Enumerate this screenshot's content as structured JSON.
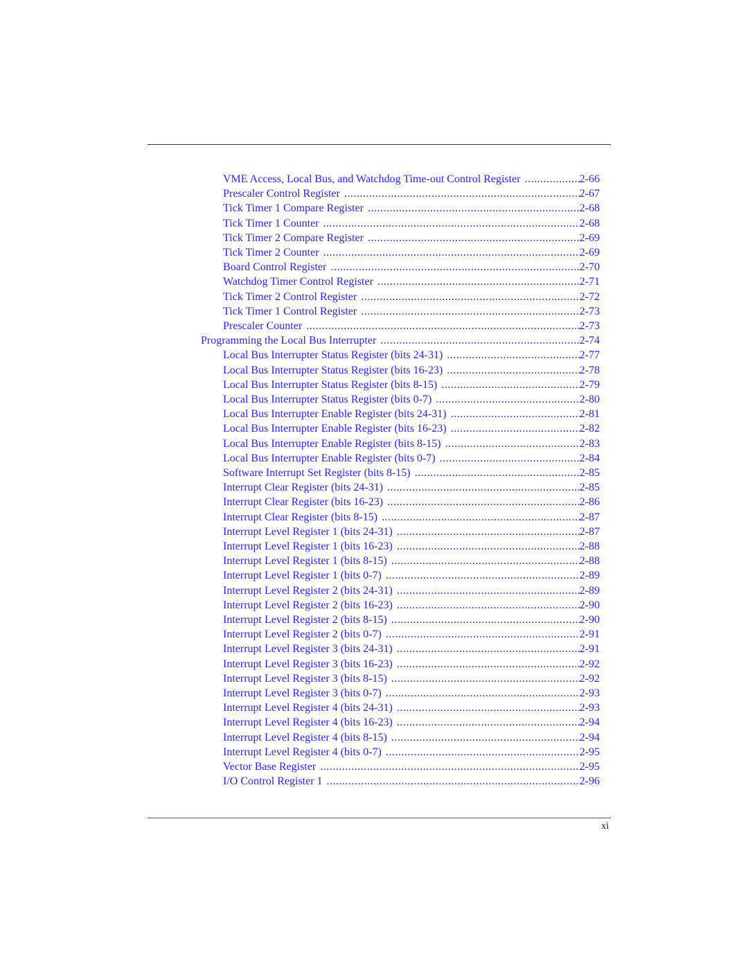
{
  "page_number": "xi",
  "colors": {
    "link": "#2424ff",
    "text": "#111111",
    "rule": "#333333"
  },
  "toc": [
    {
      "level": 2,
      "title": "VME Access, Local Bus, and Watchdog Time-out Control Register",
      "page": "2-66"
    },
    {
      "level": 2,
      "title": "Prescaler Control Register",
      "page": "2-67"
    },
    {
      "level": 2,
      "title": "Tick Timer 1 Compare Register",
      "page": "2-68"
    },
    {
      "level": 2,
      "title": "Tick Timer 1 Counter",
      "page": "2-68"
    },
    {
      "level": 2,
      "title": "Tick Timer 2 Compare Register",
      "page": "2-69"
    },
    {
      "level": 2,
      "title": "Tick Timer 2 Counter",
      "page": "2-69"
    },
    {
      "level": 2,
      "title": "Board Control Register",
      "page": "2-70"
    },
    {
      "level": 2,
      "title": "Watchdog Timer Control Register",
      "page": "2-71"
    },
    {
      "level": 2,
      "title": "Tick Timer 2 Control Register",
      "page": "2-72"
    },
    {
      "level": 2,
      "title": "Tick Timer 1 Control Register",
      "page": "2-73"
    },
    {
      "level": 2,
      "title": "Prescaler Counter",
      "page": "2-73"
    },
    {
      "level": 1,
      "title": "Programming the Local Bus Interrupter",
      "page": "2-74"
    },
    {
      "level": 2,
      "title": "Local Bus Interrupter Status Register (bits 24-31)",
      "page": "2-77"
    },
    {
      "level": 2,
      "title": "Local Bus Interrupter Status Register (bits 16-23)",
      "page": "2-78"
    },
    {
      "level": 2,
      "title": "Local Bus Interrupter Status Register (bits 8-15)",
      "page": "2-79"
    },
    {
      "level": 2,
      "title": "Local Bus Interrupter Status Register (bits 0-7)",
      "page": "2-80"
    },
    {
      "level": 2,
      "title": "Local Bus Interrupter Enable Register (bits 24-31)",
      "page": "2-81"
    },
    {
      "level": 2,
      "title": "Local Bus Interrupter Enable Register (bits 16-23)",
      "page": "2-82"
    },
    {
      "level": 2,
      "title": "Local Bus Interrupter Enable Register (bits 8-15)",
      "page": "2-83"
    },
    {
      "level": 2,
      "title": "Local Bus Interrupter Enable Register (bits 0-7)",
      "page": "2-84"
    },
    {
      "level": 2,
      "title": "Software Interrupt Set Register (bits 8-15)",
      "page": "2-85"
    },
    {
      "level": 2,
      "title": "Interrupt Clear Register (bits 24-31)",
      "page": "2-85"
    },
    {
      "level": 2,
      "title": "Interrupt Clear Register (bits 16-23)",
      "page": "2-86"
    },
    {
      "level": 2,
      "title": "Interrupt Clear Register (bits 8-15)",
      "page": "2-87"
    },
    {
      "level": 2,
      "title": "Interrupt Level Register 1 (bits 24-31)",
      "page": "2-87"
    },
    {
      "level": 2,
      "title": "Interrupt Level Register 1 (bits 16-23)",
      "page": "2-88"
    },
    {
      "level": 2,
      "title": "Interrupt Level Register 1 (bits 8-15)",
      "page": "2-88"
    },
    {
      "level": 2,
      "title": "Interrupt Level Register 1 (bits 0-7)",
      "page": "2-89"
    },
    {
      "level": 2,
      "title": "Interrupt Level Register 2 (bits 24-31)",
      "page": "2-89"
    },
    {
      "level": 2,
      "title": "Interrupt Level Register 2 (bits 16-23)",
      "page": "2-90"
    },
    {
      "level": 2,
      "title": "Interrupt Level Register 2 (bits 8-15)",
      "page": "2-90"
    },
    {
      "level": 2,
      "title": "Interrupt Level Register 2 (bits 0-7)",
      "page": "2-91"
    },
    {
      "level": 2,
      "title": "Interrupt Level Register 3 (bits 24-31)",
      "page": "2-91"
    },
    {
      "level": 2,
      "title": "Interrupt Level Register 3 (bits 16-23)",
      "page": "2-92"
    },
    {
      "level": 2,
      "title": "Interrupt Level Register 3 (bits 8-15)",
      "page": "2-92"
    },
    {
      "level": 2,
      "title": "Interrupt Level Register 3 (bits 0-7)",
      "page": "2-93"
    },
    {
      "level": 2,
      "title": "Interrupt Level Register 4 (bits 24-31)",
      "page": "2-93"
    },
    {
      "level": 2,
      "title": "Interrupt Level Register 4 (bits 16-23)",
      "page": "2-94"
    },
    {
      "level": 2,
      "title": "Interrupt Level Register 4 (bits 8-15)",
      "page": "2-94"
    },
    {
      "level": 2,
      "title": "Interrupt Level Register 4 (bits 0-7)",
      "page": "2-95"
    },
    {
      "level": 2,
      "title": "Vector Base Register",
      "page": "2-95"
    },
    {
      "level": 2,
      "title": "I/O Control Register 1",
      "page": "2-96"
    }
  ]
}
